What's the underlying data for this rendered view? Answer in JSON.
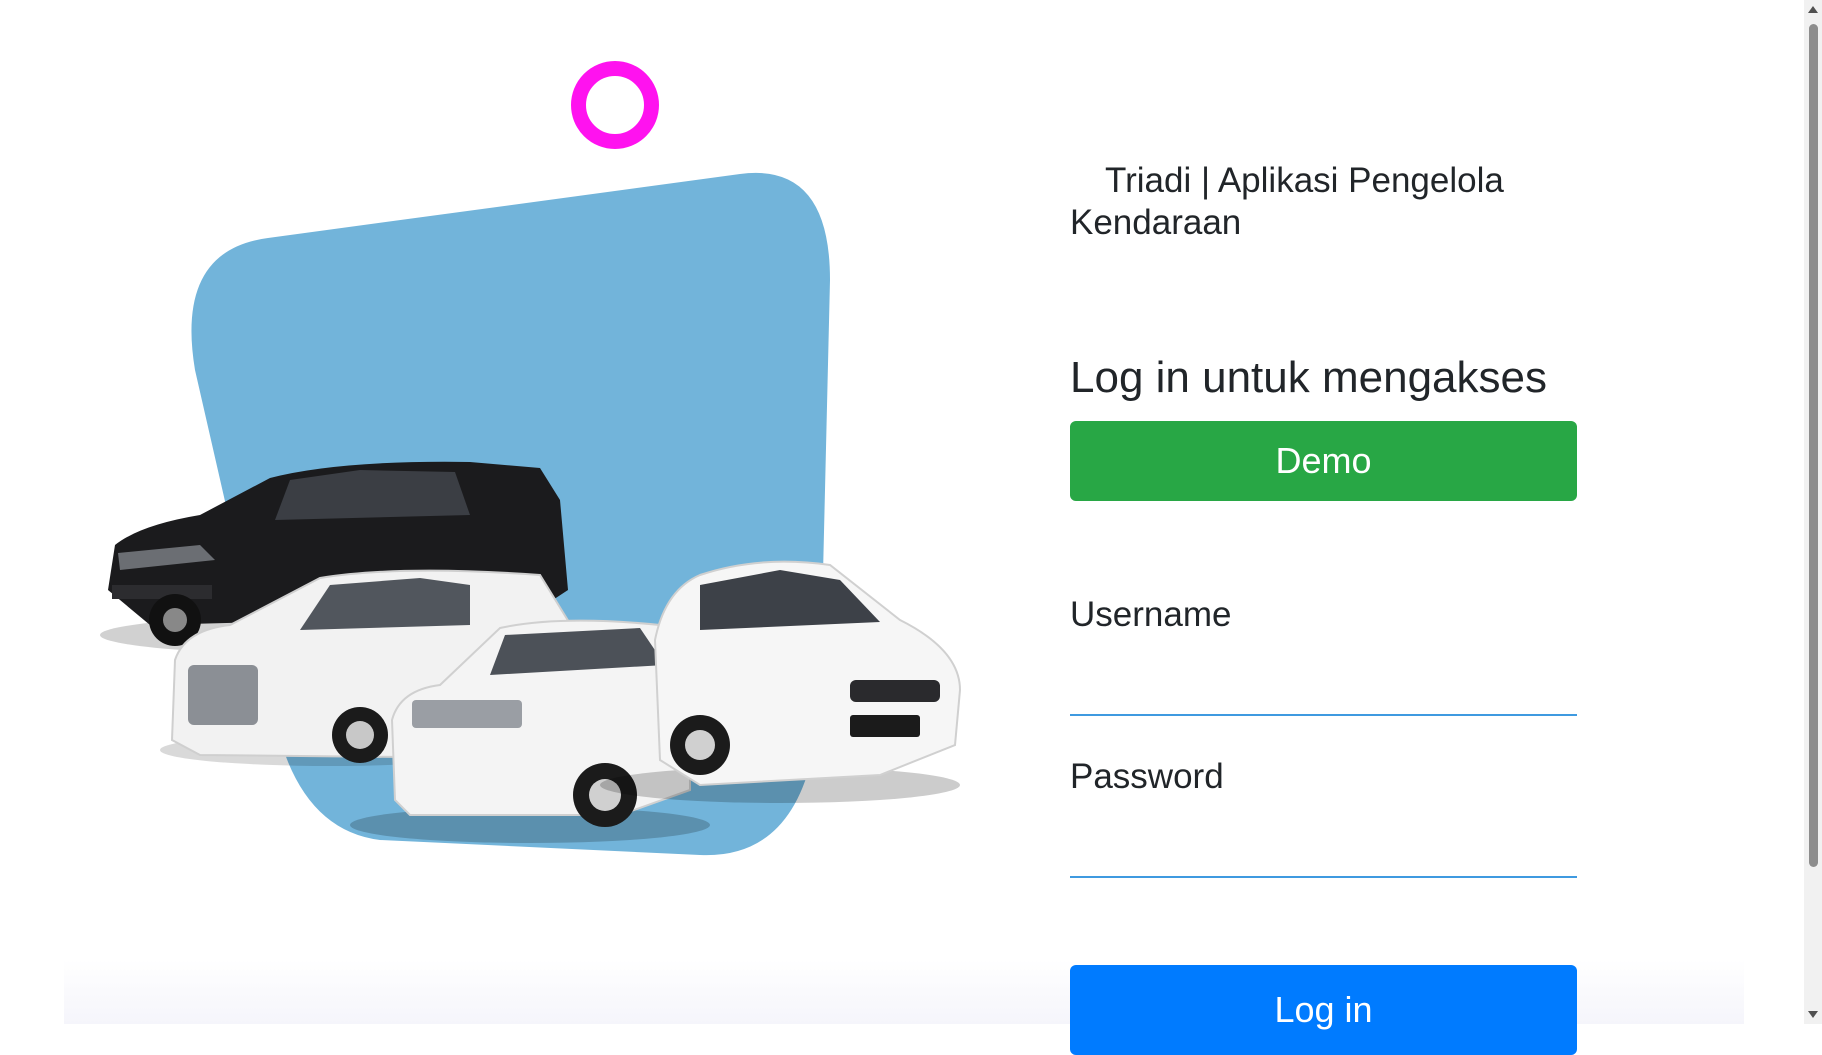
{
  "hero": {
    "ring_color": "#ff12ef",
    "blob_color": "#72b4da",
    "image_description_icon": "cars-illustration"
  },
  "panel": {
    "app_title": "Triadi | Aplikasi Pengelola Kendaraan",
    "login_heading": "Log in untuk mengakses",
    "demo_label": "Demo",
    "username_label": "Username",
    "username_value": "",
    "password_label": "Password",
    "password_value": "",
    "login_label": "Log in"
  },
  "colors": {
    "demo_button": "#28a745",
    "login_button": "#007bff",
    "input_underline": "#3f9ae0"
  }
}
